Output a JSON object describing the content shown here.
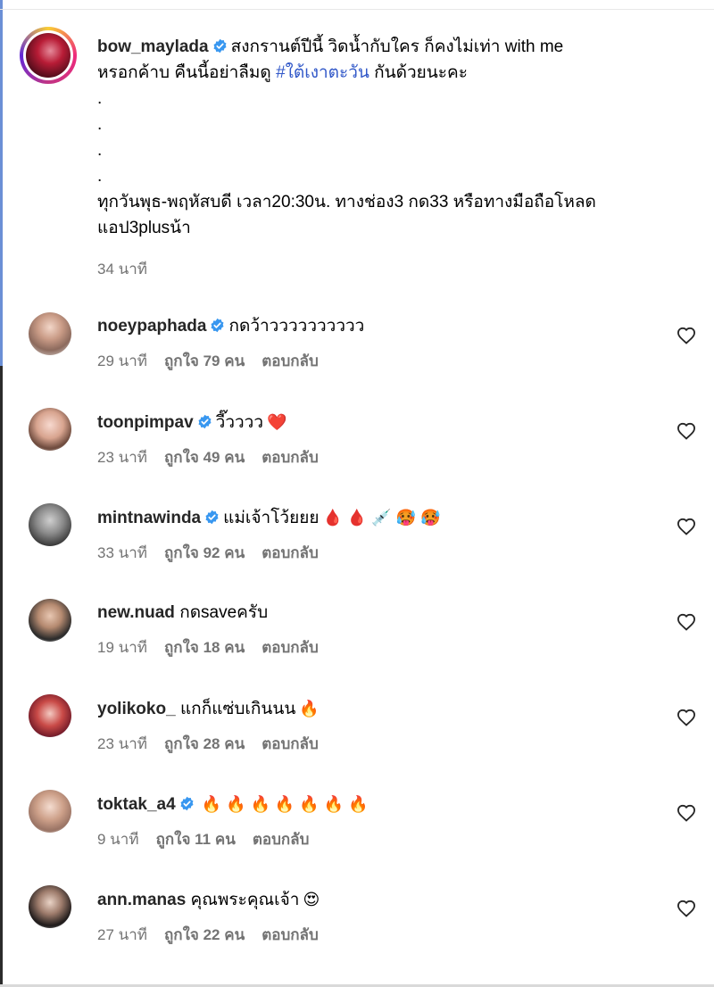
{
  "caption": {
    "username": "bow_maylada",
    "line1": "สงกรานต์ปีนี้ วิดน้ำกับใคร ก็คงไม่เท่า with me",
    "line2_prefix": "หรอกค้าบ คืนนี้อย่าลืมดู ",
    "hashtag": "#ใต้เงาตะวัน",
    "line2_suffix": " กันด้วยนะคะ",
    "dots": [
      ".",
      ".",
      ".",
      "."
    ],
    "line3": "ทุกวันพุธ-พฤหัสบดี เวลา20:30น. ทางช่อง3 กด33 หรือทางมือถือโหลด",
    "line4": "แอป3plusน้า",
    "time": "34 นาที"
  },
  "comments": [
    {
      "username": "noeypaphada",
      "verified": true,
      "text": "กดว้าวววววววววว",
      "time": "29 นาที",
      "likes": "ถูกใจ 79 คน",
      "reply": "ตอบกลับ",
      "emoji": ""
    },
    {
      "username": "toonpimpav",
      "verified": true,
      "text": "วี๊วววว",
      "time": "23 นาที",
      "likes": "ถูกใจ 49 คน",
      "reply": "ตอบกลับ",
      "emoji": "❤️"
    },
    {
      "username": "mintnawinda",
      "verified": true,
      "text": "แม่เจ้าโว้ยยย",
      "time": "33 นาที",
      "likes": "ถูกใจ 92 คน",
      "reply": "ตอบกลับ",
      "emoji": "🩸 🩸 💉 🥵 🥵"
    },
    {
      "username": "new.nuad",
      "verified": false,
      "text": "กดsaveครับ",
      "time": "19 นาที",
      "likes": "ถูกใจ 18 คน",
      "reply": "ตอบกลับ",
      "emoji": ""
    },
    {
      "username": "yolikoko_",
      "verified": false,
      "text": "แกก็แซ่บเกินนน",
      "time": "23 นาที",
      "likes": "ถูกใจ 28 คน",
      "reply": "ตอบกลับ",
      "emoji": "🔥"
    },
    {
      "username": "toktak_a4",
      "verified": true,
      "text": "",
      "time": "9 นาที",
      "likes": "ถูกใจ 11 คน",
      "reply": "ตอบกลับ",
      "emoji": "🔥 🔥 🔥 🔥 🔥 🔥 🔥"
    },
    {
      "username": "ann.manas",
      "verified": false,
      "text": "คุณพระคุณเจ้า",
      "time": "27 นาที",
      "likes": "ถูกใจ 22 คน",
      "reply": "ตอบกลับ",
      "emoji": "😍"
    }
  ],
  "colors": {
    "verified": "#3897f0",
    "hashtag": "#3057c8",
    "meta": "#737373"
  },
  "icons": {
    "like": "heart-outline-icon",
    "verified": "verified-badge-icon"
  }
}
